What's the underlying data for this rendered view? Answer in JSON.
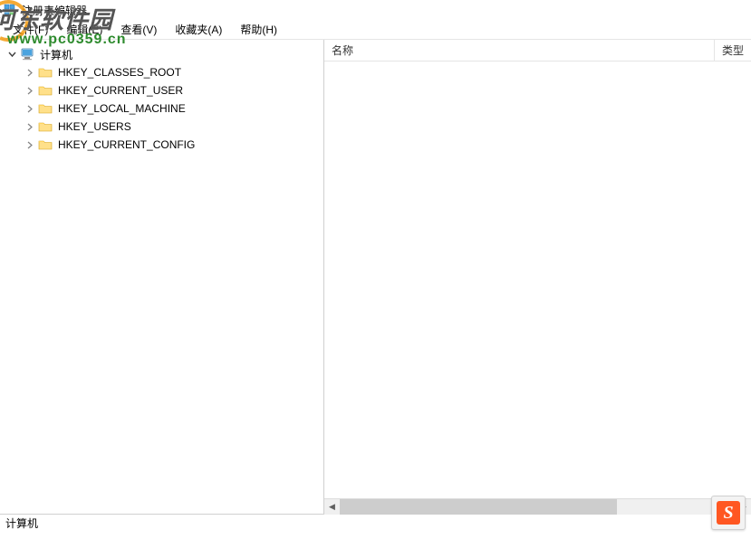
{
  "window": {
    "title": "注册表编辑器"
  },
  "menu": {
    "file": "文件(F)",
    "edit": "编辑(E)",
    "view": "查看(V)",
    "favorites": "收藏夹(A)",
    "help": "帮助(H)"
  },
  "tree": {
    "root": "计算机",
    "items": [
      "HKEY_CLASSES_ROOT",
      "HKEY_CURRENT_USER",
      "HKEY_LOCAL_MACHINE",
      "HKEY_USERS",
      "HKEY_CURRENT_CONFIG"
    ]
  },
  "list": {
    "col_name": "名称",
    "col_type": "类型"
  },
  "statusbar": {
    "path": "计算机"
  },
  "watermark": {
    "line1": "河东软件园",
    "line2": "www.pc0359.cn"
  },
  "ime": {
    "label": "S"
  }
}
